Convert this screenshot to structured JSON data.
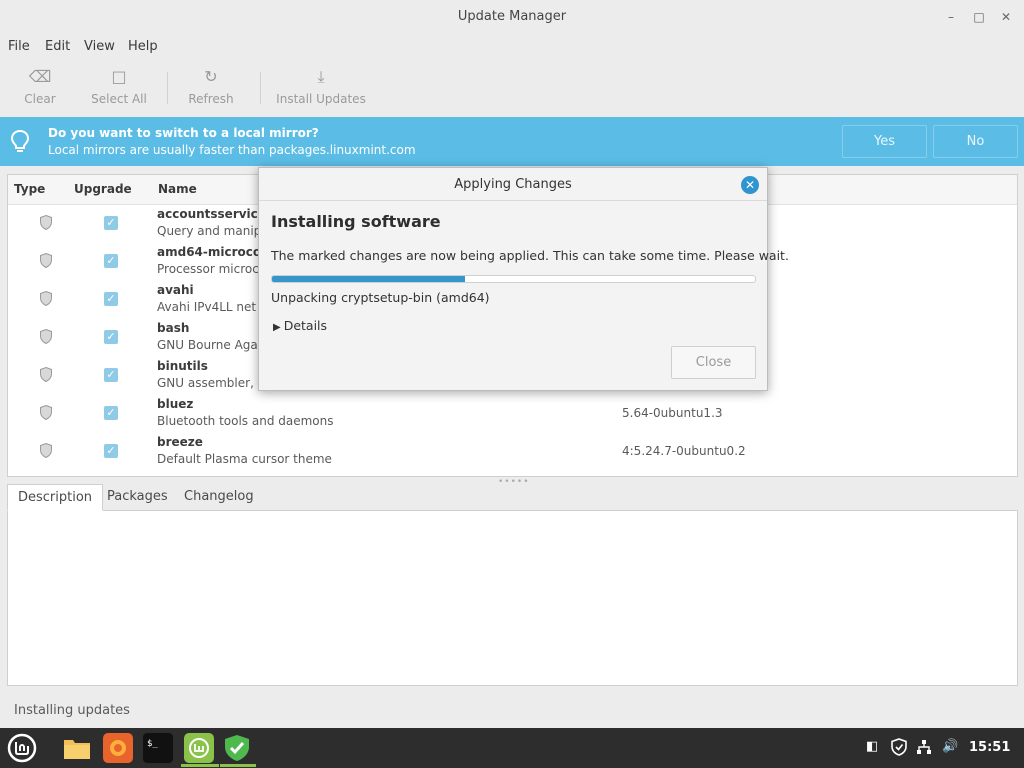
{
  "window": {
    "title": "Update Manager"
  },
  "menu": [
    "File",
    "Edit",
    "View",
    "Help"
  ],
  "toolbar": {
    "clear": "Clear",
    "select_all": "Select All",
    "refresh": "Refresh",
    "install_updates": "Install Updates"
  },
  "infobar": {
    "title": "Do you want to switch to a local mirror?",
    "subtitle": "Local mirrors are usually faster than packages.linuxmint.com",
    "yes": "Yes",
    "no": "No"
  },
  "columns": {
    "type": "Type",
    "upgrade": "Upgrade",
    "name": "Name"
  },
  "packages": [
    {
      "name": "accountsservice",
      "desc": "Query and manip",
      "version": ""
    },
    {
      "name": "amd64-microcod",
      "desc": "Processor microc",
      "version": ""
    },
    {
      "name": "avahi",
      "desc": "Avahi IPv4LL net",
      "version": ""
    },
    {
      "name": "bash",
      "desc": "GNU Bourne Aga",
      "version": ""
    },
    {
      "name": "binutils",
      "desc": "GNU assembler, l",
      "version": ""
    },
    {
      "name": "bluez",
      "desc": "Bluetooth tools and daemons",
      "version": "5.64-0ubuntu1.3"
    },
    {
      "name": "breeze",
      "desc": "Default Plasma cursor theme",
      "version": "4:5.24.7-0ubuntu0.2"
    }
  ],
  "tabs": [
    "Description",
    "Packages",
    "Changelog"
  ],
  "status": "Installing updates",
  "dialog": {
    "title": "Applying Changes",
    "heading": "Installing software",
    "message": "The marked changes are now being applied. This can take some time. Please wait.",
    "progress_percent": 40,
    "status": "Unpacking cryptsetup-bin (amd64)",
    "details": "Details",
    "close": "Close"
  },
  "taskbar": {
    "clock": "15:51"
  },
  "colors": {
    "accent": "#3596cc",
    "infobar": "#5bbde6",
    "mint_green": "#8ac24a",
    "taskbar": "#2d2d2d"
  }
}
